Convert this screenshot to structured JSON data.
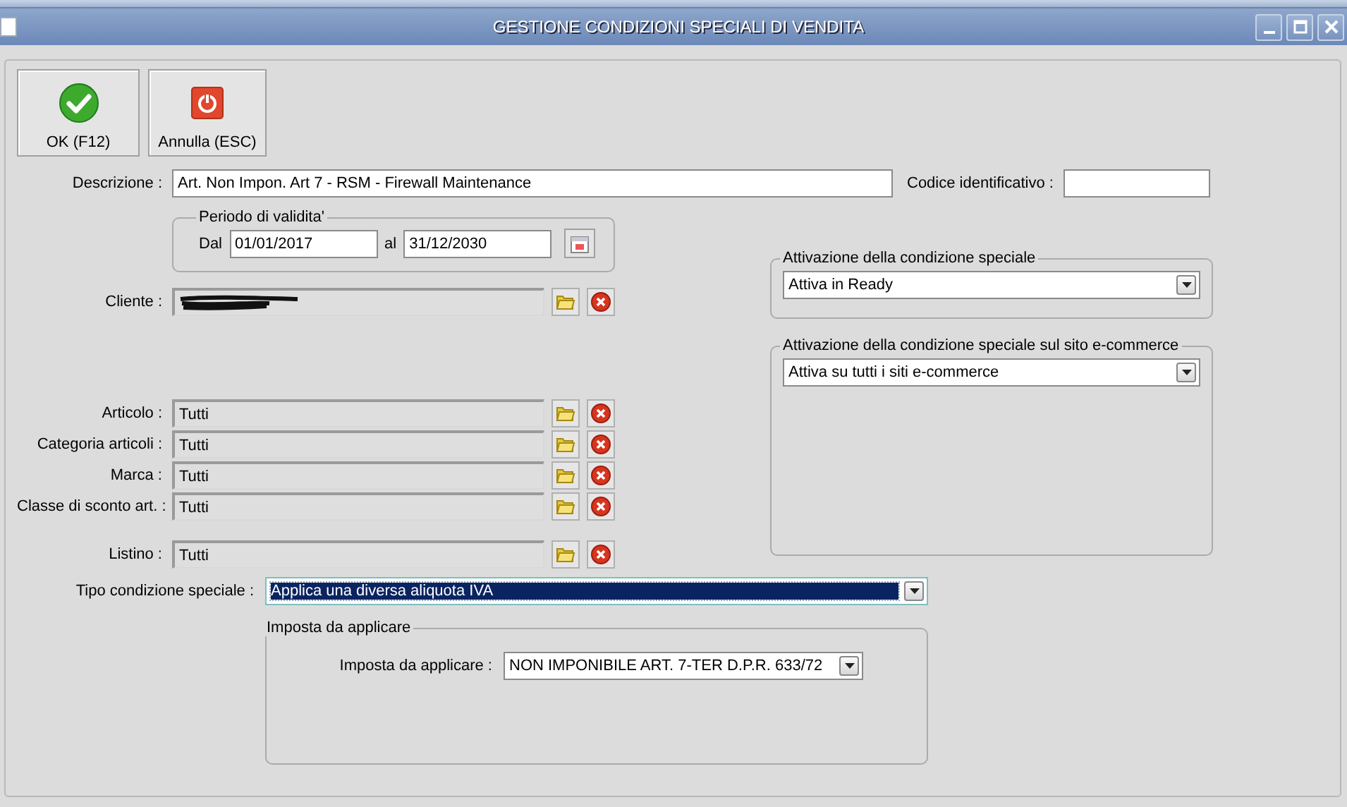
{
  "window": {
    "title": "GESTIONE CONDIZIONI SPECIALI DI VENDITA"
  },
  "toolbar": [
    {
      "label": "OK (F12)",
      "kind": "ok"
    },
    {
      "label": "Annulla (ESC)",
      "kind": "cancel"
    }
  ],
  "descrizione": {
    "label": "Descrizione :",
    "value": "Art. Non Impon. Art 7 - RSM - Firewall Maintenance"
  },
  "codice": {
    "label": "Codice identificativo :"
  },
  "periodo": {
    "title": "Periodo di validita'",
    "from_label": "Dal",
    "from": "01/01/2017",
    "to_label": "al",
    "to": "31/12/2030"
  },
  "cliente": {
    "label": "Cliente :",
    "redacted": true
  },
  "filters": [
    {
      "label": "Articolo :",
      "value": "Tutti"
    },
    {
      "label": "Categoria articoli :",
      "value": "Tutti"
    },
    {
      "label": "Marca :",
      "value": "Tutti"
    },
    {
      "label": "Classe di sconto art. :",
      "value": "Tutti"
    }
  ],
  "listino": {
    "label": "Listino :",
    "value": "Tutti"
  },
  "attivazione": {
    "title": "Attivazione della condizione speciale",
    "value": "Attiva in Ready"
  },
  "ecommerce": {
    "title": "Attivazione della condizione speciale sul sito e-commerce",
    "value": "Attiva su tutti i siti e-commerce"
  },
  "tipo": {
    "label": "Tipo condizione speciale :",
    "value": "Applica una diversa aliquota IVA",
    "focused": true
  },
  "imposta": {
    "title": "Imposta da applicare",
    "label": "Imposta da applicare :",
    "value": "NON IMPONIBILE ART. 7-TER D.P.R. 633/72"
  }
}
